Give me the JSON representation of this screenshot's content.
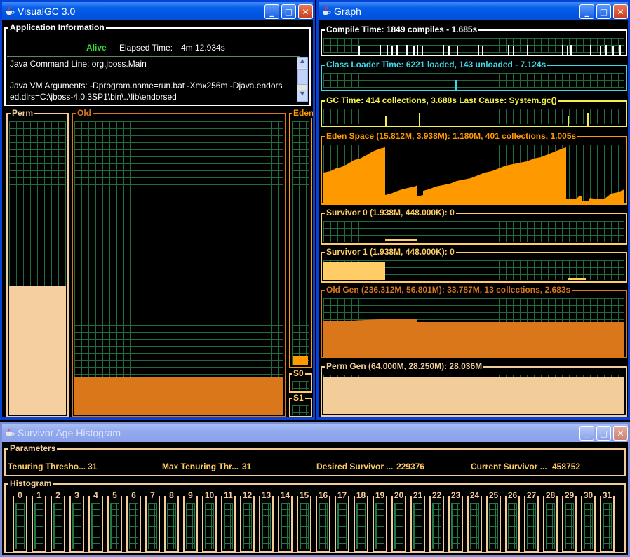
{
  "visualgc": {
    "title": "VisualGC 3.0",
    "app_info": {
      "section_title": "Application Information",
      "status": "Alive",
      "elapsed_label": "Elapsed Time:",
      "elapsed_value": "4m 12.934s",
      "command_line": "Java Command Line: org.jboss.Main",
      "vm_args_line1": "Java VM Arguments: -Dprogram.name=run.bat -Xmx256m -Djava.endors",
      "vm_args_line2": "ed.dirs=C:\\jboss-4.0.3SP1\\bin\\..\\lib\\endorsed"
    },
    "spaces": {
      "perm_label": "Perm",
      "old_label": "Old",
      "eden_label": "Eden",
      "s0_label": "S0",
      "s1_label": "S1",
      "perm_fill": 0.44,
      "old_fill": 0.13,
      "eden_fill": 0.04,
      "s0_fill": 0,
      "s1_fill": 0
    }
  },
  "graph": {
    "title": "Graph",
    "rows": [
      {
        "label": "Compile Time: 1849 compiles - 1.685s",
        "color": "#ffffff"
      },
      {
        "label": "Class Loader Time: 6221 loaded, 143 unloaded - 7.124s",
        "color": "#3cd7e8"
      },
      {
        "label": "GC Time: 414 collections, 3.688s  Last Cause: System.gc()",
        "color": "#f2f04a"
      },
      {
        "label": "Eden Space (15.812M, 3.938M): 1.180M, 401 collections, 1.005s",
        "color": "#ff9900"
      },
      {
        "label": "Survivor 0 (1.938M, 448.000K): 0",
        "color": "#ffcc66"
      },
      {
        "label": "Survivor 1 (1.938M, 448.000K): 0",
        "color": "#ffcc66"
      },
      {
        "label": "Old Gen (236.312M, 56.801M): 33.787M, 13 collections, 2.683s",
        "color": "#d9771a"
      },
      {
        "label": "Perm Gen (64.000M, 28.250M): 28.036M",
        "color": "#f2cc99"
      }
    ]
  },
  "histogram": {
    "title": "Survivor Age Histogram",
    "params_title": "Parameters",
    "params": [
      {
        "label": "Tenuring Thresho...",
        "value": "31"
      },
      {
        "label": "Max Tenuring Thr...",
        "value": "31"
      },
      {
        "label": "Desired Survivor ...",
        "value": "229376"
      },
      {
        "label": "Current Survivor ...",
        "value": "458752"
      }
    ],
    "hist_title": "Histogram",
    "ages": [
      "0",
      "1",
      "2",
      "3",
      "4",
      "5",
      "6",
      "7",
      "8",
      "9",
      "10",
      "11",
      "12",
      "13",
      "14",
      "15",
      "16",
      "17",
      "18",
      "19",
      "20",
      "21",
      "22",
      "23",
      "24",
      "25",
      "26",
      "27",
      "28",
      "29",
      "30",
      "31"
    ]
  },
  "colors": {
    "perm": "#f5cfa0",
    "old": "#d9771a",
    "eden": "#ff9900",
    "grid": "#1f6b3c",
    "alive": "#33dd33",
    "title_bar_active": "#0054e3"
  },
  "window_buttons": {
    "minimize": "_",
    "maximize": "□",
    "close": "✕"
  }
}
